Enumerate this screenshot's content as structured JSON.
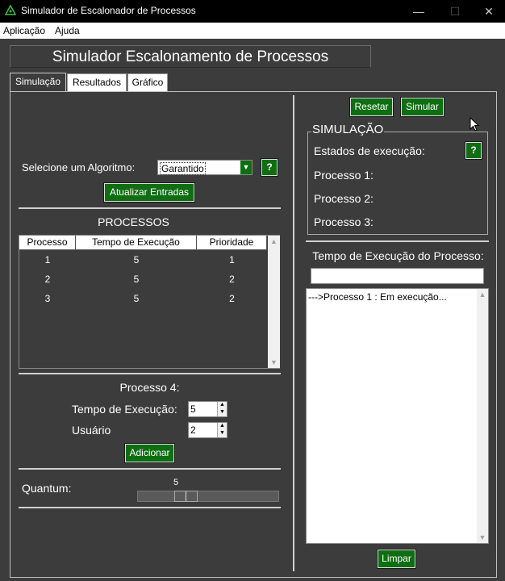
{
  "window": {
    "title": "Simulador de Escalonador de Processos",
    "minimize": "—",
    "maximize": "☐",
    "close": "✕"
  },
  "menu": {
    "items": [
      "Aplicação",
      "Ajuda"
    ]
  },
  "heading": "Simulador Escalonamento de Processos",
  "tabs": [
    "Simulação",
    "Resultados",
    "Gráfico"
  ],
  "left": {
    "algo_label": "Selecione um Algoritmo:",
    "algo_value": "Garantido",
    "help": "?",
    "update_button": "Atualizar Entradas",
    "processes_title": "PROCESSOS",
    "table": {
      "columns": [
        "Processo",
        "Tempo de Execução",
        "Prioridade"
      ],
      "rows": [
        [
          "1",
          "5",
          "1"
        ],
        [
          "2",
          "5",
          "2"
        ],
        [
          "3",
          "5",
          "2"
        ]
      ]
    },
    "new_process_title": "Processo 4:",
    "exec_time_label": "Tempo de Execução:",
    "exec_time_value": "5",
    "user_label": "Usuário",
    "user_value": "2",
    "add_button": "Adicionar",
    "quantum_label": "Quantum:",
    "quantum_value": "5",
    "quantum_level": 0.26
  },
  "right": {
    "reset_button": "Resetar",
    "simulate_button": "Simular",
    "sim_group_title": "SIMULAÇÃO",
    "states_label": "Estados de execução:",
    "help": "?",
    "process1": "Processo 1:",
    "process2": "Processo 2:",
    "process3": "Processo 3:",
    "exec_time_title": "Tempo de Execução do Processo:",
    "exec_time_input": "",
    "log_lines": [
      "--->Processo 1 : Em execução..."
    ],
    "clear_button": "Limpar"
  },
  "colors": {
    "accent_green": "#0f6e12",
    "background": "#3c3c3c"
  }
}
